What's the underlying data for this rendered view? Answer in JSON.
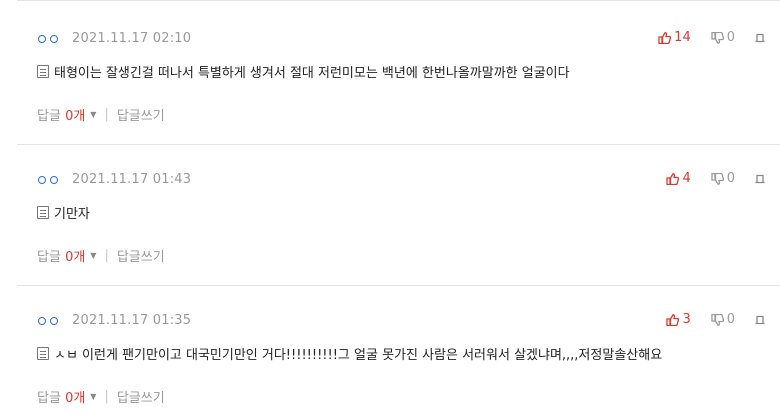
{
  "comments": [
    {
      "date": "2021.11.17 02:10",
      "likes": "14",
      "dislikes": "0",
      "text": "태형이는 잘생긴걸 떠나서 특별하게 생겨서 절대 저런미모는 백년에 한번나올까말까한 얼굴이다",
      "reply_label": "답글",
      "reply_count": "0개",
      "write_reply": "답글쓰기"
    },
    {
      "date": "2021.11.17 01:43",
      "likes": "4",
      "dislikes": "0",
      "text": "기만자",
      "reply_label": "답글",
      "reply_count": "0개",
      "write_reply": "답글쓰기"
    },
    {
      "date": "2021.11.17 01:35",
      "likes": "3",
      "dislikes": "0",
      "text": "ㅅㅂ 이런게 팬기만이고 대국민기만인 거다!!!!!!!!!!그 얼굴 못가진 사람은 서러워서 살겠냐며,,,,저정말솔산해요",
      "reply_label": "답글",
      "reply_count": "0개",
      "write_reply": "답글쓰기"
    }
  ],
  "colors": {
    "accent": "#e2362b",
    "nick": "#2a6fd6",
    "muted": "#9a9a9a",
    "divider": "#e4e4e4"
  },
  "icons": [
    "nickname-circles-icon",
    "thumbs-up-icon",
    "thumbs-down-icon",
    "report-icon",
    "document-icon",
    "caret-down-icon"
  ]
}
